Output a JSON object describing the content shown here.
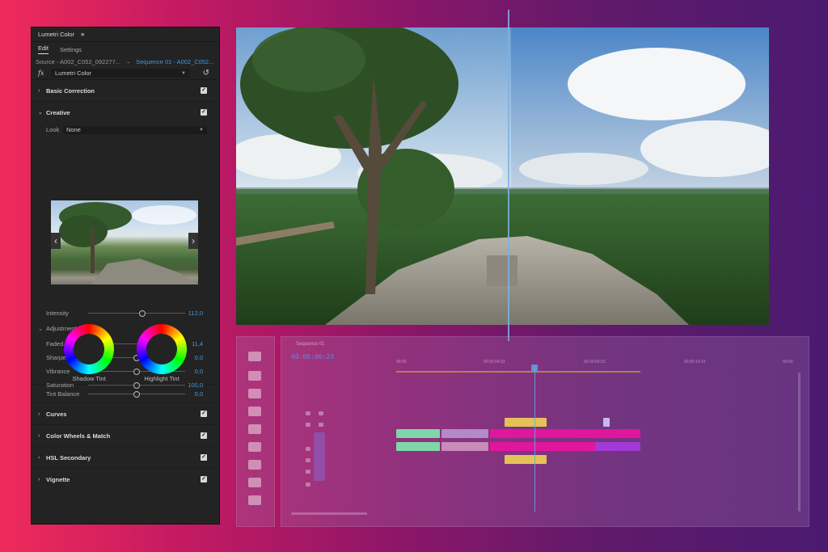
{
  "panel": {
    "title": "Lumetri Color",
    "menu_icon": "≡",
    "tabs": [
      "Edit",
      "Settings"
    ],
    "source_label": "Source - A002_C052_092277...",
    "sequence_label": "Sequence 01 - A002_C052...",
    "fx_label": "fx",
    "effect_name": "Lumetri Color",
    "sections": {
      "basic_correction": "Basic Correction",
      "creative": "Creative",
      "curves": "Curves",
      "color_wheels": "Color Wheels & Match",
      "hsl_secondary": "HSL Secondary",
      "vignette": "Vignette"
    },
    "look_label": "Look",
    "look_value": "None",
    "intensity": {
      "label": "Intensity",
      "value": "112,0",
      "level": 0.56
    },
    "adjustments_label": "Adjustments",
    "adjustments": [
      {
        "label": "Faded Film",
        "value": "11,4",
        "level": 0.11
      },
      {
        "label": "Sharpen",
        "value": "0,0",
        "level": 0.5
      },
      {
        "label": "Vibrance",
        "value": "0,0",
        "level": 0.5
      },
      {
        "label": "Saturation",
        "value": "100,0",
        "level": 0.5
      }
    ],
    "shadow_tint_label": "Shadow Tint",
    "highlight_tint_label": "Highlight Tint",
    "tint_balance": {
      "label": "Tint Balance",
      "value": "0,0",
      "level": 0.5
    }
  },
  "viewer": {
    "split_position": 0.51
  },
  "timeline": {
    "sequence_tab": "Sequence 01",
    "timecode": "00:00:06:23",
    "ruler_labels": [
      "00:00",
      "00:00:04:23",
      "00:00:09:23",
      "00:00:14:23",
      "00:00"
    ]
  },
  "colors": {
    "accent_blue": "#3d9be9",
    "panel_bg": "#232323",
    "clip_magenta": "#e0169c",
    "clip_green": "#7fd6a8",
    "clip_violet": "#a23ad8",
    "clip_yellow": "#e3c257"
  }
}
